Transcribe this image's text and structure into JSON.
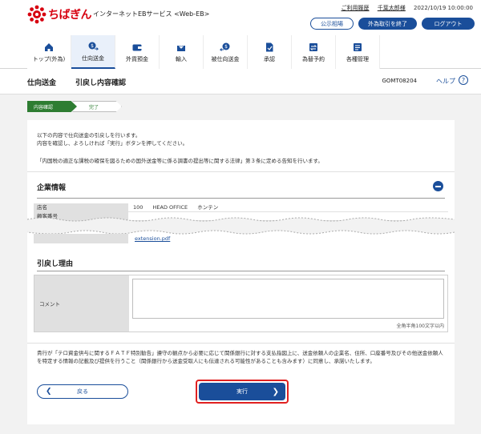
{
  "header": {
    "bank_logo_text": "ちばぎん",
    "service_name": "インターネットEBサービス <Web-EB>",
    "usage_history": "ご利用履歴",
    "user_name": "千葉太郎様",
    "datetime": "2022/10/19 10:00:00",
    "public_rates": "公示相場",
    "fx_end": "外為取引を終了",
    "logout": "ログアウト"
  },
  "nav": {
    "items": [
      {
        "label": "トップ(外為)",
        "icon": "home-icon"
      },
      {
        "label": "仕向送金",
        "icon": "money-send-icon",
        "active": true
      },
      {
        "label": "外貨預金",
        "icon": "wallet-icon"
      },
      {
        "label": "輸入",
        "icon": "import-icon"
      },
      {
        "label": "被仕向送金",
        "icon": "money-receive-icon"
      },
      {
        "label": "承認",
        "icon": "approve-icon"
      },
      {
        "label": "為替予約",
        "icon": "fx-contract-icon"
      },
      {
        "label": "各種管理",
        "icon": "management-icon"
      }
    ]
  },
  "page": {
    "title": "仕向送金",
    "subtitle": "引戻し内容確認",
    "code": "GOMT08204",
    "help": "ヘルプ",
    "help_q": "?"
  },
  "steps": [
    "内容確認",
    "完了"
  ],
  "intro": {
    "line1": "以下の内容で仕向送金の引戻しを行います。",
    "line2": "内容を確認し、よろしければ「実行」ボタンを押してください。",
    "law": "「内国税の適正な課税の確保を図るための国外送金等に係る調書の提出等に関する法律」第３条に定める告知を行います。"
  },
  "company_section": {
    "heading": "企業情報",
    "store_label": "店名",
    "store_code": "100",
    "store_name_en": "HEAD OFFICE",
    "store_name_kana": "ホンテン",
    "customer_no_label": "顧客番号",
    "attachment": "extension.pdf"
  },
  "reason_section": {
    "heading": "引戻し理由",
    "comment_label": "コメント",
    "comment_value": "",
    "hint": "全角半角100文字以内"
  },
  "notice": "貴行が「テロ資金供与に関するＦＡＴＦ特別勧告」遵守の観点から必要に応じて関係銀行に対する支払指図上に、送金依頼人の企業名、住所、口座番号及びその他送金依頼人を特定する情報の記載及び提供を行うこと（関係銀行から送金受取人にも伝達される可能性があることも含みます）に同意し、承諾いたします。",
  "buttons": {
    "back": "戻る",
    "execute": "実行"
  },
  "colors": {
    "brand_red": "#d7000f",
    "primary_blue": "#1a4e9a",
    "step_green": "#2e7d32",
    "highlight_red": "#e02020"
  }
}
